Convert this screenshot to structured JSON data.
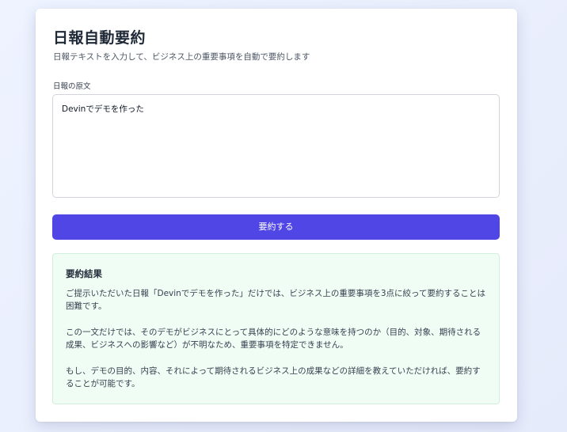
{
  "header": {
    "title": "日報自動要約",
    "subtitle": "日報テキストを入力して、ビジネス上の重要事項を自動で要約します"
  },
  "form": {
    "label": "日報の原文",
    "input_value": "Devinでデモを作った",
    "submit_label": "要約する"
  },
  "result": {
    "title": "要約結果",
    "paragraphs": [
      "ご提示いただいた日報「Devinでデモを作った」だけでは、ビジネス上の重要事項を3点に絞って要約することは困難です。",
      "この一文だけでは、そのデモがビジネスにとって具体的にどのような意味を持つのか（目的、対象、期待される成果、ビジネスへの影響など）が不明なため、重要事項を特定できません。",
      "もし、デモの目的、内容、それによって期待されるビジネス上の成果などの詳細を教えていただければ、要約することが可能です。"
    ]
  },
  "colors": {
    "accent": "#4f46e5",
    "result_bg": "#f0fdf4"
  }
}
